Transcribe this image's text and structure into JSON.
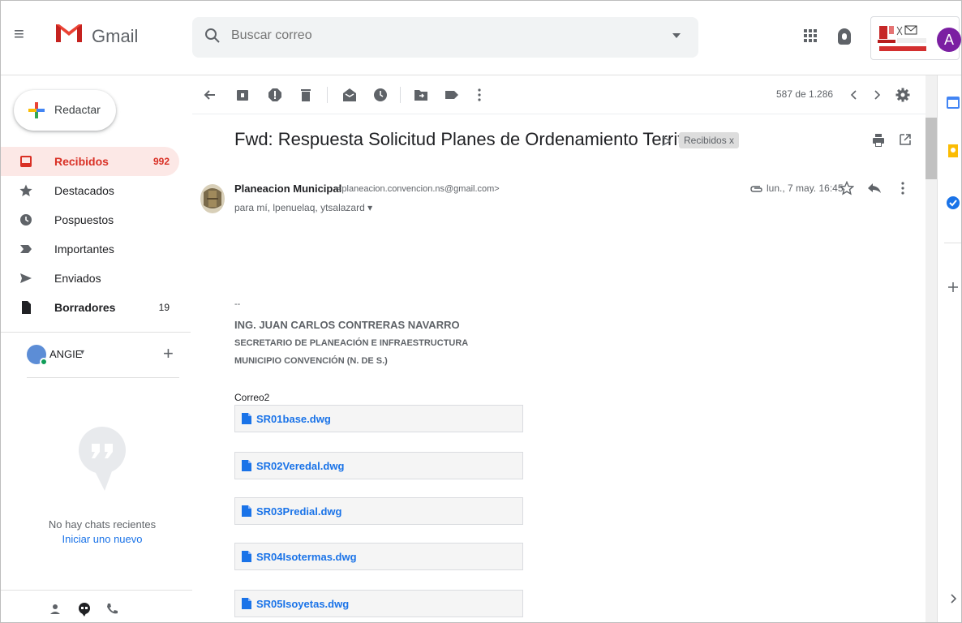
{
  "header": {
    "menu_label": "≡",
    "app_name": "Gmail",
    "search_placeholder": "Buscar correo",
    "account_initial": "A"
  },
  "compose": {
    "label": "Redactar"
  },
  "nav": {
    "items": [
      {
        "label": "Recibidos",
        "count": "992",
        "icon": "inbox-icon"
      },
      {
        "label": "Destacados",
        "count": "",
        "icon": "star-icon"
      },
      {
        "label": "Pospuestos",
        "count": "",
        "icon": "clock-icon"
      },
      {
        "label": "Importantes",
        "count": "",
        "icon": "important-icon"
      },
      {
        "label": "Enviados",
        "count": "",
        "icon": "send-icon"
      },
      {
        "label": "Borradores",
        "count": "19",
        "icon": "draft-icon"
      }
    ]
  },
  "hangouts": {
    "user_name": "ANGIE",
    "caret": "▾",
    "add": "+",
    "no_chats": "No hay chats recientes",
    "start_new": "Iniciar uno nuevo"
  },
  "toolbar": {
    "count_text": "587 de 1.286"
  },
  "message": {
    "subject": "Fwd: Respuesta Solicitud Planes de Ordenamiento Territorial",
    "importance_marker": "ᐅ",
    "label": "Recibidos x",
    "sender_name": "Planeacion Municipal",
    "sender_email": "<planeacion.convencion.ns@gmail.com>",
    "recipients": "para mí, lpenuelaq, ytsalazard ▾",
    "date": "lun., 7 may. 16:45",
    "signature": {
      "dash": "--",
      "name": "ING. JUAN CARLOS CONTRERAS NAVARRO",
      "title": "SECRETARIO DE PLANEACIÓN E INFRAESTRUCTURA",
      "municipality": "MUNICIPIO CONVENCIÓN (N. DE S.)"
    },
    "correo_label": "Correo2",
    "attachments": [
      "SR01base.dwg",
      "SR02Veredal.dwg",
      "SR03Predial.dwg",
      "SR04Isotermas.dwg",
      "SR05Isoyetas.dwg"
    ]
  },
  "colors": {
    "accent_red": "#d93025",
    "link_blue": "#1a73e8",
    "active_bg": "#fce8e6"
  }
}
